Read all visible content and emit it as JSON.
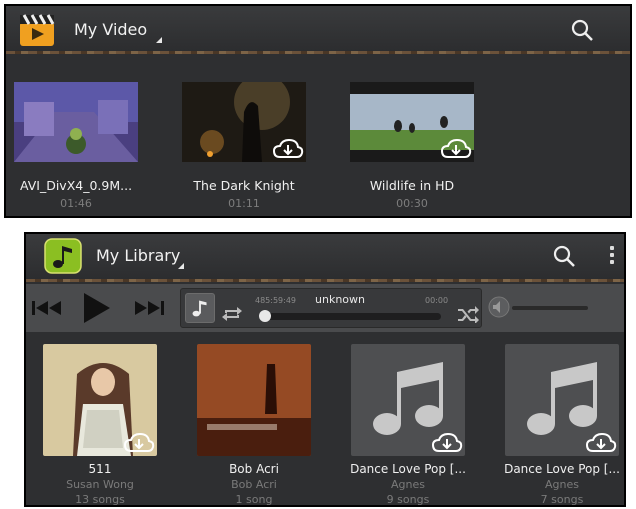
{
  "video": {
    "title": "My Video",
    "items": [
      {
        "title": "AVI_DivX4_0.9M...",
        "duration": "01:46",
        "downloadable": false
      },
      {
        "title": "The Dark Knight",
        "duration": "01:11",
        "downloadable": true
      },
      {
        "title": "Wildlife in HD",
        "duration": "00:30",
        "downloadable": true
      }
    ]
  },
  "library": {
    "title": "My Library",
    "player": {
      "track": "unknown",
      "elapsed": "485:59:49",
      "remaining": "00:00"
    },
    "albums": [
      {
        "title": "511",
        "artist": "Susan Wong",
        "count": "13 songs"
      },
      {
        "title": "Bob Acri",
        "artist": "Bob Acri",
        "count": "1 song"
      },
      {
        "title": "Dance Love Pop [...",
        "artist": "Agnes",
        "count": "9 songs"
      },
      {
        "title": "Dance Love Pop [...",
        "artist": "Agnes",
        "count": "7 songs"
      }
    ]
  },
  "icons": {
    "video_app": "clapperboard-icon",
    "music_app": "music-note-icon",
    "search": "search-icon",
    "overflow": "overflow-menu-icon",
    "download": "cloud-download-icon",
    "prev": "previous-icon",
    "play": "play-icon",
    "next": "next-icon",
    "repeat": "repeat-icon",
    "shuffle": "shuffle-icon",
    "volume": "volume-icon"
  },
  "colors": {
    "panel_bg": "#2e2f31",
    "accent_wood": "#5a4632",
    "text_primary": "#f0f0f0",
    "text_secondary": "#7d7d7d"
  }
}
